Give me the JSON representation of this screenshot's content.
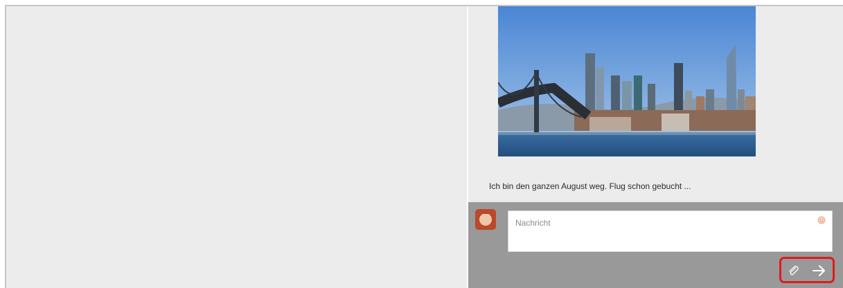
{
  "conversation": {
    "image_alt": "San Francisco skyline with Bay Bridge",
    "message_text": "Ich bin den ganzen August weg. Flug schon gebucht ..."
  },
  "composer": {
    "placeholder": "Nachricht",
    "emoji_icon": "smiley-icon",
    "attach_icon": "paperclip-icon",
    "send_icon": "arrow-right-icon"
  },
  "colors": {
    "pane_bg": "#ececec",
    "composer_bg": "#999999",
    "highlight": "#e11a1a"
  }
}
